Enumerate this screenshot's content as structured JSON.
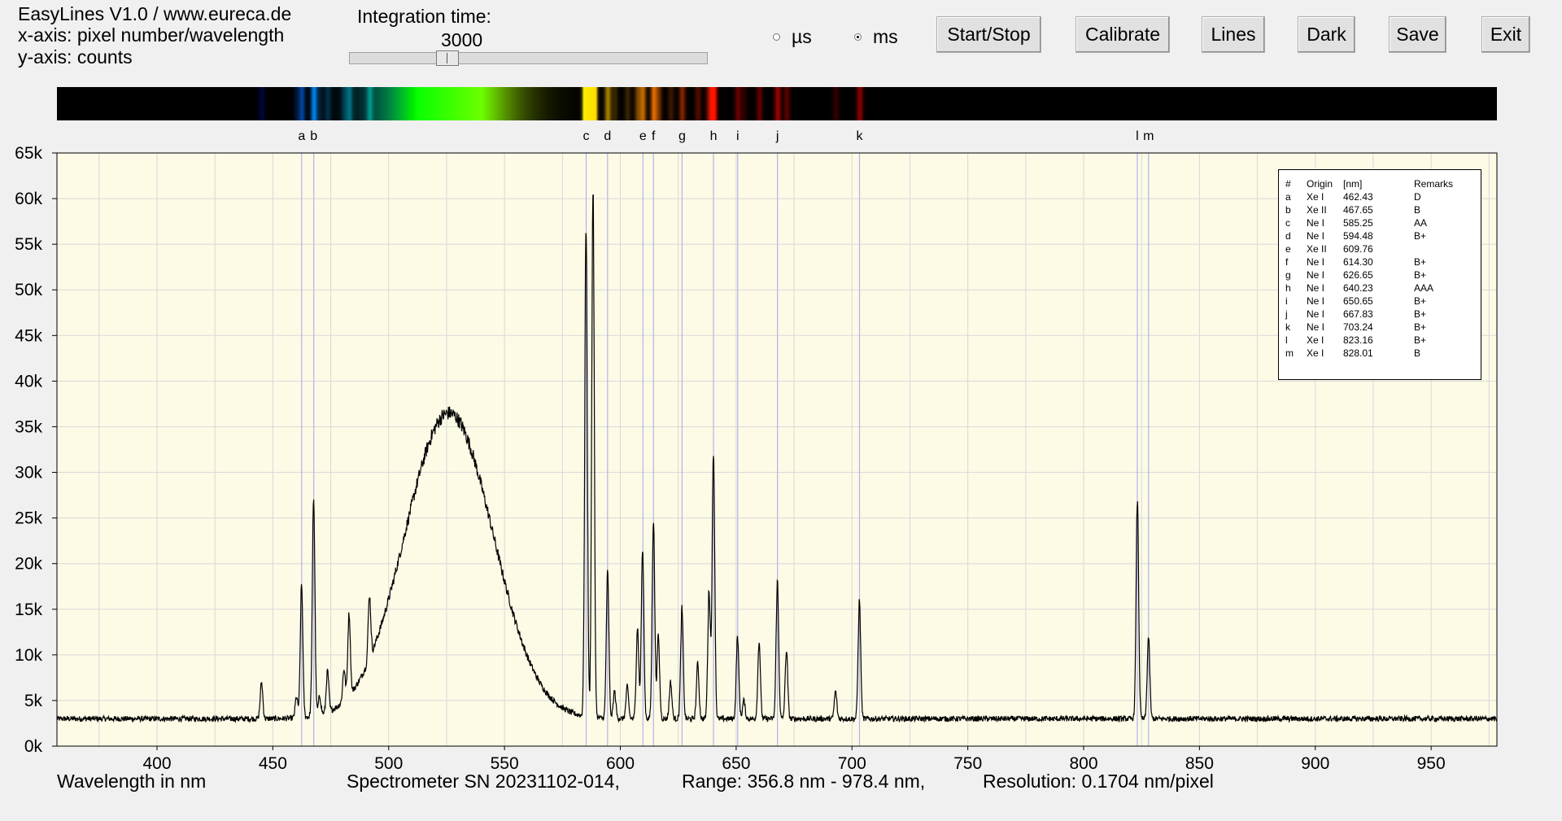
{
  "app": {
    "title": "EasyLines V1.0 / www.eureca.de",
    "x_axis_info": "x-axis: pixel number/wavelength",
    "y_axis_info": "y-axis: counts"
  },
  "integration": {
    "label": "Integration time:",
    "value": "3000",
    "slider_fraction": 0.26
  },
  "units": {
    "us_label": "µs",
    "ms_label": "ms",
    "selected": "ms"
  },
  "buttons": {
    "start_stop": "Start/Stop",
    "calibrate": "Calibrate",
    "lines": "Lines",
    "dark": "Dark",
    "save": "Save",
    "exit": "Exit"
  },
  "footer": {
    "xlabel": "Wavelength in nm",
    "spectrometer": "Spectrometer SN 20231102-014,",
    "range": "Range: 356.8 nm - 978.4 nm,",
    "resolution": "Resolution: 0.1704 nm/pixel"
  },
  "legend": {
    "headers": [
      "#",
      "Origin",
      "[nm]",
      "Remarks"
    ],
    "rows": [
      {
        "id": "a",
        "origin": "Xe I",
        "nm": "462.43",
        "remarks": "D"
      },
      {
        "id": "b",
        "origin": "Xe II",
        "nm": "467.65",
        "remarks": "B"
      },
      {
        "id": "c",
        "origin": "Ne I",
        "nm": "585.25",
        "remarks": "AA"
      },
      {
        "id": "d",
        "origin": "Ne I",
        "nm": "594.48",
        "remarks": "B+"
      },
      {
        "id": "e",
        "origin": "Xe II",
        "nm": "609.76",
        "remarks": ""
      },
      {
        "id": "f",
        "origin": "Ne I",
        "nm": "614.30",
        "remarks": "B+"
      },
      {
        "id": "g",
        "origin": "Ne I",
        "nm": "626.65",
        "remarks": "B+"
      },
      {
        "id": "h",
        "origin": "Ne I",
        "nm": "640.23",
        "remarks": "AAA"
      },
      {
        "id": "i",
        "origin": "Ne I",
        "nm": "650.65",
        "remarks": "B+"
      },
      {
        "id": "j",
        "origin": "Ne I",
        "nm": "667.83",
        "remarks": "B+"
      },
      {
        "id": "k",
        "origin": "Ne I",
        "nm": "703.24",
        "remarks": "B+"
      },
      {
        "id": "l",
        "origin": "Xe I",
        "nm": "823.16",
        "remarks": "B+"
      },
      {
        "id": "m",
        "origin": "Xe I",
        "nm": "828.01",
        "remarks": "B"
      }
    ]
  },
  "chart_data": {
    "type": "line",
    "xlim": [
      356.8,
      978.4
    ],
    "ylim": [
      0,
      65000
    ],
    "x_ticks": [
      400,
      450,
      500,
      550,
      600,
      650,
      700,
      750,
      800,
      850,
      900,
      950
    ],
    "y_ticks": [
      0,
      5000,
      10000,
      15000,
      20000,
      25000,
      30000,
      35000,
      40000,
      45000,
      50000,
      55000,
      60000,
      65000
    ],
    "y_tick_labels": [
      "0k",
      "5k",
      "10k",
      "15k",
      "20k",
      "25k",
      "30k",
      "35k",
      "40k",
      "45k",
      "50k",
      "55k",
      "60k",
      "65k"
    ],
    "grid": true,
    "baseline": 3000,
    "continuum": {
      "center": 526,
      "sigma": 19,
      "peak": 36500
    },
    "peaks": [
      {
        "x": 445.1,
        "y": 7000
      },
      {
        "x": 460.2,
        "y": 5300
      },
      {
        "x": 462.4,
        "y": 17500
      },
      {
        "x": 467.6,
        "y": 27000
      },
      {
        "x": 470.2,
        "y": 5000
      },
      {
        "x": 473.6,
        "y": 7500
      },
      {
        "x": 480.7,
        "y": 6500
      },
      {
        "x": 482.9,
        "y": 12000
      },
      {
        "x": 491.7,
        "y": 10000
      },
      {
        "x": 585.2,
        "y": 57000
      },
      {
        "x": 588.2,
        "y": 61000
      },
      {
        "x": 594.5,
        "y": 19000
      },
      {
        "x": 597.5,
        "y": 6000
      },
      {
        "x": 603.0,
        "y": 6500
      },
      {
        "x": 607.4,
        "y": 13000
      },
      {
        "x": 609.6,
        "y": 21500
      },
      {
        "x": 614.3,
        "y": 25000
      },
      {
        "x": 616.4,
        "y": 12000
      },
      {
        "x": 621.7,
        "y": 7000
      },
      {
        "x": 626.6,
        "y": 15000
      },
      {
        "x": 633.4,
        "y": 9000
      },
      {
        "x": 638.3,
        "y": 17000
      },
      {
        "x": 640.2,
        "y": 32500
      },
      {
        "x": 650.6,
        "y": 12000
      },
      {
        "x": 653.3,
        "y": 5000
      },
      {
        "x": 659.9,
        "y": 11500
      },
      {
        "x": 667.8,
        "y": 18000
      },
      {
        "x": 671.7,
        "y": 10500
      },
      {
        "x": 692.9,
        "y": 6000
      },
      {
        "x": 703.2,
        "y": 16000
      },
      {
        "x": 823.2,
        "y": 27000
      },
      {
        "x": 828.0,
        "y": 12000
      }
    ],
    "line_markers": [
      {
        "id": "a",
        "x": 462.43
      },
      {
        "id": "b",
        "x": 467.65
      },
      {
        "id": "c",
        "x": 585.25
      },
      {
        "id": "d",
        "x": 594.48
      },
      {
        "id": "e",
        "x": 609.76
      },
      {
        "id": "f",
        "x": 614.3
      },
      {
        "id": "g",
        "x": 626.65
      },
      {
        "id": "h",
        "x": 640.23
      },
      {
        "id": "i",
        "x": 650.65
      },
      {
        "id": "j",
        "x": 667.83
      },
      {
        "id": "k",
        "x": 703.24
      },
      {
        "id": "l",
        "x": 823.16
      },
      {
        "id": "m",
        "x": 828.01
      }
    ],
    "colors": {
      "plot_bg": "#fdfae6",
      "grid": "#d8d8d8",
      "marker_line": "#b4b4e6",
      "trace": "#000000"
    }
  }
}
